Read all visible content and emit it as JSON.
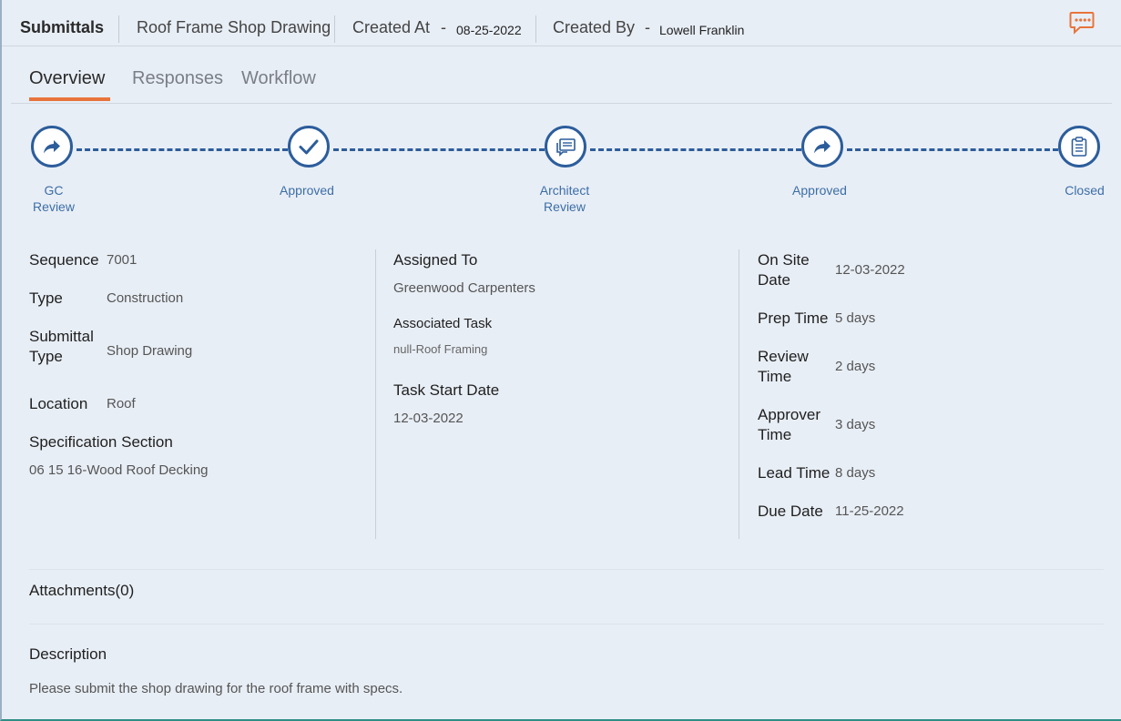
{
  "header": {
    "title": "Submittals",
    "name": "Roof Frame Shop Drawing",
    "created_at_label": "Created At",
    "created_at_dash": "-",
    "created_at_value": "08-25-2022",
    "created_by_label": "Created By",
    "created_by_dash": "-",
    "created_by_value": "Lowell Franklin",
    "chat_icon": "chat-bubble-icon",
    "accent_color": "#e8743b"
  },
  "tabs": [
    {
      "label": "Overview",
      "active": true
    },
    {
      "label": "Responses",
      "active": false
    },
    {
      "label": "Workflow",
      "active": false
    }
  ],
  "workflow": {
    "color": "#2c5d9b",
    "steps": [
      {
        "label_line1": "GC",
        "label_line2": "Review",
        "icon": "share-arrow-icon"
      },
      {
        "label_line1": "Approved",
        "label_line2": "",
        "icon": "checkmark-icon"
      },
      {
        "label_line1": "Architect",
        "label_line2": "Review",
        "icon": "comments-icon"
      },
      {
        "label_line1": "Approved",
        "label_line2": "",
        "icon": "share-arrow-icon"
      },
      {
        "label_line1": "Closed",
        "label_line2": "",
        "icon": "clipboard-icon"
      }
    ]
  },
  "details": {
    "col1": {
      "sequence_label": "Sequence",
      "sequence_value": "7001",
      "type_label": "Type",
      "type_value": "Construction",
      "submittal_type_label_1": "Submittal",
      "submittal_type_label_2": "Type",
      "submittal_type_value": "Shop Drawing",
      "location_label": "Location",
      "location_value": "Roof",
      "spec_label": "Specification Section",
      "spec_value": "06 15 16-Wood Roof Decking"
    },
    "col2": {
      "assigned_label": "Assigned To",
      "assigned_value": "Greenwood Carpenters",
      "task_label": "Associated Task",
      "task_value": "null-Roof Framing",
      "start_label": "Task Start Date",
      "start_value": "12-03-2022"
    },
    "col3": {
      "onsite_label_1": "On Site",
      "onsite_label_2": "Date",
      "onsite_value": "12-03-2022",
      "prep_label": "Prep Time",
      "prep_value": "5 days",
      "review_label_1": "Review",
      "review_label_2": "Time",
      "review_value": "2 days",
      "approver_label_1": "Approver",
      "approver_label_2": "Time",
      "approver_value": "3 days",
      "lead_label": "Lead Time",
      "lead_value": "8 days",
      "due_label": "Due Date",
      "due_value": "11-25-2022"
    }
  },
  "attachments": {
    "label": "Attachments(0)"
  },
  "description": {
    "label": "Description",
    "text": "Please submit the shop drawing for the roof frame with specs."
  }
}
